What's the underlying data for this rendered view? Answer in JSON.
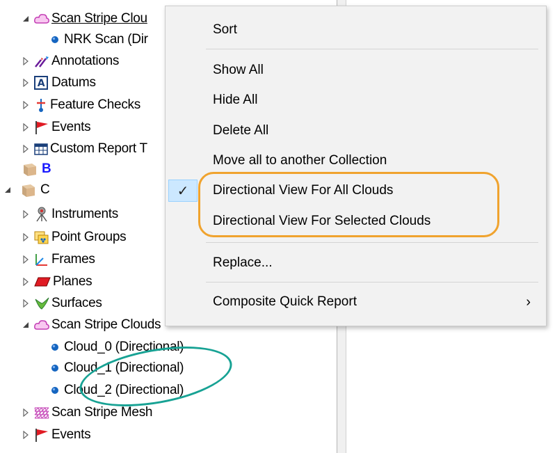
{
  "tree": [
    {
      "label": "Scan Stripe Clou",
      "icon": "cloud-icon",
      "expander": "expanded",
      "underline": true
    },
    {
      "label": "NRK Scan (Dir",
      "icon": "dot-icon",
      "expander": "none"
    },
    {
      "label": "Annotations",
      "icon": "annotations-icon",
      "expander": "collapsed"
    },
    {
      "label": "Datums",
      "icon": "datums-icon",
      "expander": "collapsed"
    },
    {
      "label": "Feature Checks",
      "icon": "feature-checks-icon",
      "expander": "collapsed"
    },
    {
      "label": "Events",
      "icon": "flag-icon",
      "expander": "collapsed"
    },
    {
      "label": "Custom Report T",
      "icon": "table-icon",
      "expander": "collapsed"
    },
    {
      "label": "B",
      "icon": "collection-icon",
      "expander": "none",
      "bold_blue": true
    },
    {
      "label": "C",
      "icon": "collection-icon",
      "expander": "expanded"
    },
    {
      "label": "Instruments",
      "icon": "instrument-icon",
      "expander": "collapsed"
    },
    {
      "label": "Point Groups",
      "icon": "point-groups-icon",
      "expander": "collapsed"
    },
    {
      "label": "Frames",
      "icon": "frames-icon",
      "expander": "collapsed"
    },
    {
      "label": "Planes",
      "icon": "planes-icon",
      "expander": "collapsed"
    },
    {
      "label": "Surfaces",
      "icon": "surfaces-icon",
      "expander": "collapsed"
    },
    {
      "label": "Scan Stripe Clouds",
      "icon": "cloud-icon",
      "expander": "expanded"
    },
    {
      "label": "Cloud_0 (Directional)",
      "icon": "dot-icon",
      "expander": "none"
    },
    {
      "label": "Cloud_1 (Directional)",
      "icon": "dot-icon",
      "expander": "none"
    },
    {
      "label": "Cloud_2 (Directional)",
      "icon": "dot-icon",
      "expander": "none"
    },
    {
      "label": "Scan Stripe Mesh",
      "icon": "mesh-icon",
      "expander": "collapsed"
    },
    {
      "label": "Events",
      "icon": "flag-icon",
      "expander": "collapsed"
    }
  ],
  "menu": {
    "items": [
      {
        "label": "Sort"
      },
      {
        "label": "Show All"
      },
      {
        "label": "Hide All"
      },
      {
        "label": "Delete All"
      },
      {
        "label": "Move all to another Collection"
      },
      {
        "label": "Directional View For All Clouds",
        "checked": true
      },
      {
        "label": "Directional View For Selected Clouds"
      },
      {
        "label": "Replace..."
      },
      {
        "label": "Composite Quick Report",
        "submenu": true
      }
    ],
    "check_mark": "✓",
    "submenu_arrow": "›"
  },
  "colors": {
    "highlight_orange": "#f0a32e",
    "highlight_teal": "#17a294",
    "check_cell": "#cce8ff",
    "dot_blue": "#1565c0"
  }
}
